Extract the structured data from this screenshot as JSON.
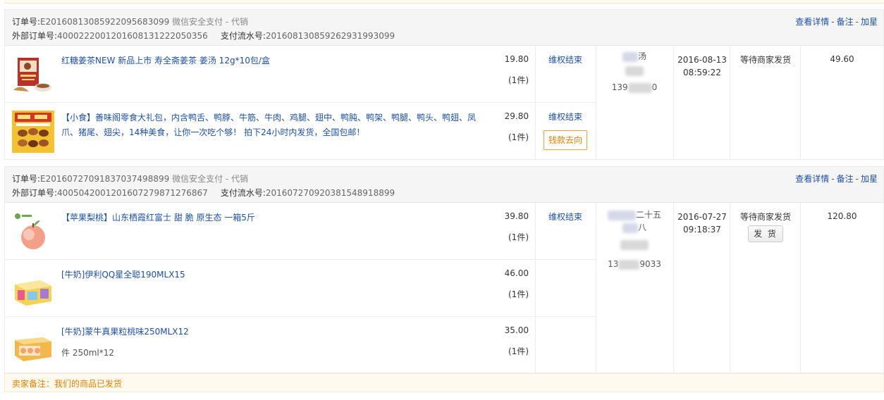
{
  "orders": [
    {
      "order_label": "订单号:",
      "order_no": "E20160813085922095683099",
      "pay_type": "微信安全支付 - 代销",
      "ext_label": "外部订单号:",
      "ext_no": "4000222001201608131222050356",
      "flow_label": "支付流水号:",
      "flow_no": "2016081308592629319930​99",
      "links": {
        "detail": "查看详情",
        "note": "备注",
        "star": "加星"
      },
      "items": [
        {
          "name": "红糖姜茶NEW 新品上市 寿全斋姜茶 姜汤 12g*10包/盒",
          "price": "19.80",
          "qty": "(1件)",
          "refund": "维权结束"
        },
        {
          "name": "【小食】善味阁零食大礼包，内含鸭舌、鸭脖、牛筋、牛肉、鸡腿、翅中、鸭肫、鸭架、鸭腿、鸭头、鸭翅、凤爪、猪尾、翅尖，14种美食，让你一次吃个够！ 拍下24小时内发货，全国包邮！",
          "price": "29.80",
          "qty": "(1件)",
          "refund": "维权结束",
          "money_btn": "钱款去向"
        }
      ],
      "buyer": {
        "line1": "汤",
        "line2": "",
        "phone": "139",
        "phone_tail": "0"
      },
      "time": {
        "date": "2016-08-13",
        "clock": "08:59:22"
      },
      "status": "等待商家发货",
      "total": "49.60"
    },
    {
      "order_label": "订单号:",
      "order_no": "E20160727091837037498899",
      "pay_type": "微信安全支付 - 代销",
      "ext_label": "外部订单号:",
      "ext_no": "4005042001201607279871276867",
      "flow_label": "支付流水号:",
      "flow_no": "2016072709203815489188​99",
      "links": {
        "detail": "查看详情",
        "note": "备注",
        "star": "加星"
      },
      "items": [
        {
          "name": "【苹果梨桃】山东栖霞红富士 甜 脆 原生态 一箱5斤",
          "price": "39.80",
          "qty": "(1件)",
          "refund": "维权结束"
        },
        {
          "name": "[牛奶]伊利QQ星全聪190MLX15",
          "price": "46.00",
          "qty": "(1件)"
        },
        {
          "name": "[牛奶]蒙牛真果粒桃味250MLX12",
          "spec": "件 250ml*12",
          "price": "35.00",
          "qty": "(1件)"
        }
      ],
      "buyer": {
        "line1": "二十五",
        "line2": "八",
        "phone": "13",
        "phone_tail": "9033"
      },
      "time": {
        "date": "2016-07-27",
        "clock": "09:18:37"
      },
      "status": "等待商家发货",
      "ship_btn": "发 货",
      "total": "120.80"
    }
  ],
  "remark": {
    "label": "卖家备注：",
    "text": "我们的商品已发货"
  },
  "colors": {
    "link": "#1e50a2",
    "remark_text": "#e08000",
    "remark_bg": "#fffaf0",
    "header_bg": "#f5f5f5"
  },
  "icons": [
    "ginger-tea-product-image",
    "snack-pack-product-image",
    "apple-product-image",
    "milk-box-product-image",
    "fruit-milk-product-image"
  ]
}
